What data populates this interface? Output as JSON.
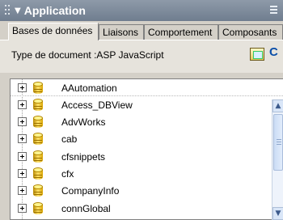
{
  "panel": {
    "title": "Application",
    "collapse_icon": "triangle-down-icon",
    "options_icon": "options-menu-icon"
  },
  "tabs": [
    {
      "label": "Bases de données",
      "active": true
    },
    {
      "label": "Liaisons",
      "active": false
    },
    {
      "label": "Comportement",
      "active": false
    },
    {
      "label": "Composants",
      "active": false
    }
  ],
  "document_type": {
    "label": "Type de document :ASP JavaScript",
    "button_icon": "edit-document-icon",
    "extra_text": "C"
  },
  "databases": [
    {
      "name": "AAutomation"
    },
    {
      "name": "Access_DBView"
    },
    {
      "name": "AdvWorks"
    },
    {
      "name": "cab"
    },
    {
      "name": "cfsnippets"
    },
    {
      "name": "cfx"
    },
    {
      "name": "CompanyInfo"
    },
    {
      "name": "connGlobal"
    }
  ],
  "colors": {
    "header_top": "#8e9aa9",
    "header_bottom": "#6f7d8f",
    "panel_bg": "#d4d0c8",
    "active_tab_bg": "#e6e3dc",
    "db_icon": "#e0b100"
  }
}
